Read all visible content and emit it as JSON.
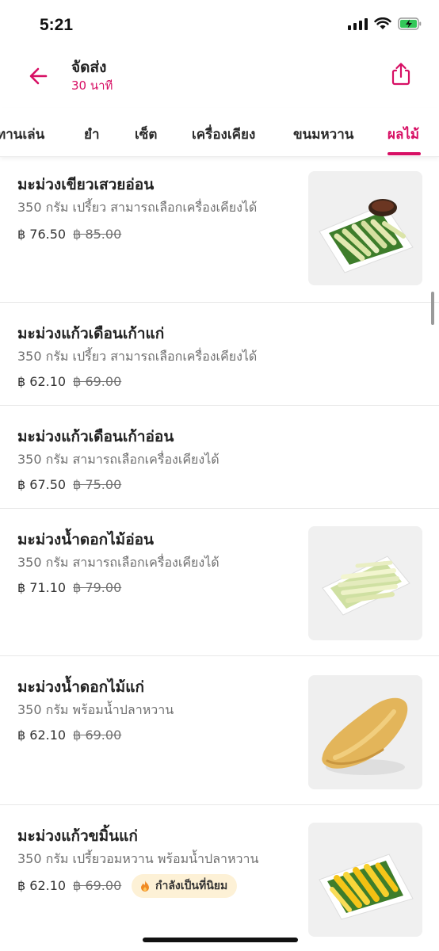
{
  "status": {
    "time": "5:21"
  },
  "header": {
    "title": "จัดส่ง",
    "subtitle": "30 นาที"
  },
  "tabs": [
    {
      "label": "ทานเล่น"
    },
    {
      "label": "ยำ"
    },
    {
      "label": "เซ็ต"
    },
    {
      "label": "เครื่องเคียง"
    },
    {
      "label": "ขนมหวาน"
    },
    {
      "label": "ผลไม้",
      "active": true
    }
  ],
  "items": [
    {
      "name": "มะม่วงเขียวเสวยอ่อน",
      "description": "350 กรัม เปรี้ยว สามารถเลือกเครื่องเคียงได้",
      "price": "฿ 76.50",
      "original_price": "฿ 85.00",
      "image": "green-mango-slices-with-dip"
    },
    {
      "name": "มะม่วงแก้วเดือนเก้าแก่",
      "description": "350 กรัม เปรี้ยว สามารถเลือกเครื่องเคียงได้",
      "price": "฿ 62.10",
      "original_price": "฿ 69.00"
    },
    {
      "name": "มะม่วงแก้วเดือนเก้าอ่อน",
      "description": "350 กรัม สามารถเลือกเครื่องเคียงได้",
      "price": "฿ 67.50",
      "original_price": "฿ 75.00"
    },
    {
      "name": "มะม่วงน้ำดอกไม้อ่อน",
      "description": "350 กรัม สามารถเลือกเครื่องเคียงได้",
      "price": "฿ 71.10",
      "original_price": "฿ 79.00",
      "image": "pale-mango-slices"
    },
    {
      "name": "มะม่วงน้ำดอกไม้แก่",
      "description": "350 กรัม พร้อมน้ำปลาหวาน",
      "price": "฿ 62.10",
      "original_price": "฿ 69.00",
      "image": "whole-ripe-mango"
    },
    {
      "name": "มะม่วงแก้วขมิ้นแก่",
      "description": "350 กรัม เปรี้ยวอมหวาน พร้อมน้ำปลาหวาน",
      "price": "฿ 62.10",
      "original_price": "฿ 69.00",
      "badge": "กำลังเป็นที่นิยม",
      "image": "yellow-mango-slices"
    }
  ],
  "colors": {
    "accent": "#d70f64",
    "badge_bg": "#fdf1d6"
  }
}
